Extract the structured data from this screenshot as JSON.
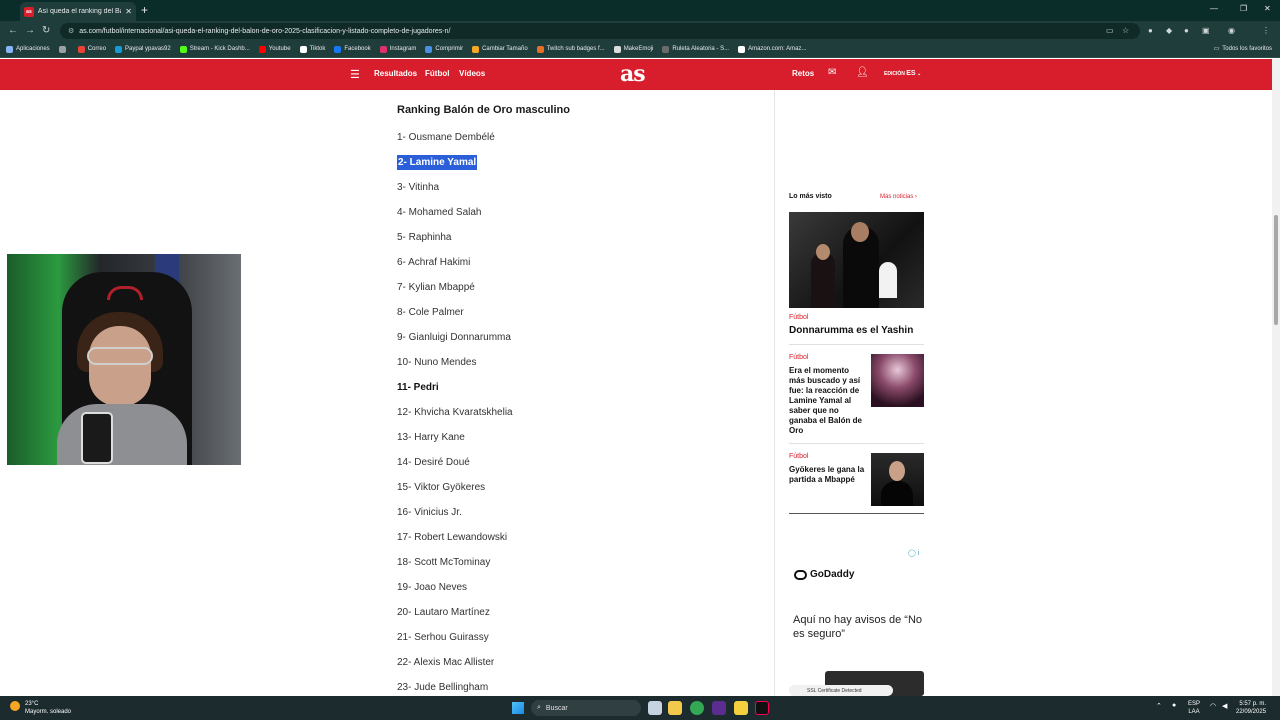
{
  "browser": {
    "tab_title": "Así queda el ranking del Balón",
    "tab_favicon_text": "as",
    "new_tab": "+",
    "url": "as.com/futbol/internacional/asi-queda-el-ranking-del-balon-de-oro-2025-clasificacion-y-listado-completo-de-jugadores-n/",
    "bookmarks": [
      {
        "label": "Aplicaciones",
        "color": "#8ab4f8"
      },
      {
        "label": "",
        "color": "#9aa0a6"
      },
      {
        "label": "Correo",
        "color": "#ea4335"
      },
      {
        "label": "Paypal ypavas92",
        "color": "#179bd7"
      },
      {
        "label": "Stream - Kick Dashb...",
        "color": "#53fc18"
      },
      {
        "label": "Youtube",
        "color": "#ff0000"
      },
      {
        "label": "Tiktok",
        "color": "#ffffff"
      },
      {
        "label": "Facebook",
        "color": "#1877f2"
      },
      {
        "label": "Instagram",
        "color": "#e1306c"
      },
      {
        "label": "Comprimir",
        "color": "#4a90e2"
      },
      {
        "label": "Cambiar Tamaño",
        "color": "#f5a623"
      },
      {
        "label": "Twitch sub badges f...",
        "color": "#e76f24"
      },
      {
        "label": "MakeEmoji",
        "color": "#dddddd"
      },
      {
        "label": "Ruleta Aleatoria - S...",
        "color": "#6b6b6b"
      },
      {
        "label": "Amazon.com: Amaz...",
        "color": "#ffffff"
      }
    ],
    "bookmarks_right": "Todos los favoritos"
  },
  "site": {
    "nav": [
      "Resultados",
      "Fútbol",
      "Vídeos"
    ],
    "logo": "as",
    "retos": "Retos",
    "edition_label": "EDICIÓN",
    "edition_value": "ES"
  },
  "article": {
    "section_title": "Ranking Balón de Oro masculino",
    "rankings": [
      {
        "text": "1- Ousmane Dembélé",
        "style": "normal"
      },
      {
        "text": "2- Lamine Yamal",
        "style": "selected"
      },
      {
        "text": "3- Vitinha",
        "style": "normal"
      },
      {
        "text": "4- Mohamed Salah",
        "style": "normal"
      },
      {
        "text": "5- Raphinha",
        "style": "normal"
      },
      {
        "text": "6- Achraf Hakimi",
        "style": "normal"
      },
      {
        "text": "7- Kylian Mbappé",
        "style": "normal"
      },
      {
        "text": "8- Cole Palmer",
        "style": "normal"
      },
      {
        "text": "9- Gianluigi Donnarumma",
        "style": "normal"
      },
      {
        "text": "10- Nuno Mendes",
        "style": "normal"
      },
      {
        "text": "11- Pedri",
        "style": "bold"
      },
      {
        "text": "12- Khvicha Kvaratskhelia",
        "style": "normal"
      },
      {
        "text": "13- Harry Kane",
        "style": "normal"
      },
      {
        "text": "14- Desiré Doué",
        "style": "normal"
      },
      {
        "text": "15- Viktor Gyökeres",
        "style": "normal"
      },
      {
        "text": "16- Vinicius Jr.",
        "style": "normal"
      },
      {
        "text": "17- Robert Lewandowski",
        "style": "normal"
      },
      {
        "text": "18- Scott McTominay",
        "style": "normal"
      },
      {
        "text": "19- Joao Neves",
        "style": "normal"
      },
      {
        "text": "20- Lautaro Martínez",
        "style": "normal"
      },
      {
        "text": "21- Serhou Guirassy",
        "style": "normal"
      },
      {
        "text": "22- Alexis Mac Allister",
        "style": "normal"
      },
      {
        "text": "23- Jude Bellingham",
        "style": "normal"
      }
    ]
  },
  "sidebar": {
    "most_viewed": "Lo más visto",
    "more_news": "Más noticias ›",
    "stories": [
      {
        "category": "Fútbol",
        "headline": "Donnarumma es el Yashin"
      },
      {
        "category": "Fútbol",
        "headline": "Era el momento más buscado y así fue: la reacción de Lamine Yamal al saber que no ganaba el Balón de Oro"
      },
      {
        "category": "Fútbol",
        "headline": "Gyökeres le gana la partida a Mbappé"
      }
    ],
    "ad_brand": "GoDaddy",
    "ad_text": "Aquí no hay avisos de “No es seguro”",
    "ad_badge": "SSL Certificate Detected"
  },
  "taskbar": {
    "temperature": "23°C",
    "weather": "Mayorm. soleado",
    "search": "Buscar",
    "lang_1": "ESP",
    "lang_2": "LAA",
    "time": "5:57 p. m.",
    "date": "22/09/2025"
  }
}
